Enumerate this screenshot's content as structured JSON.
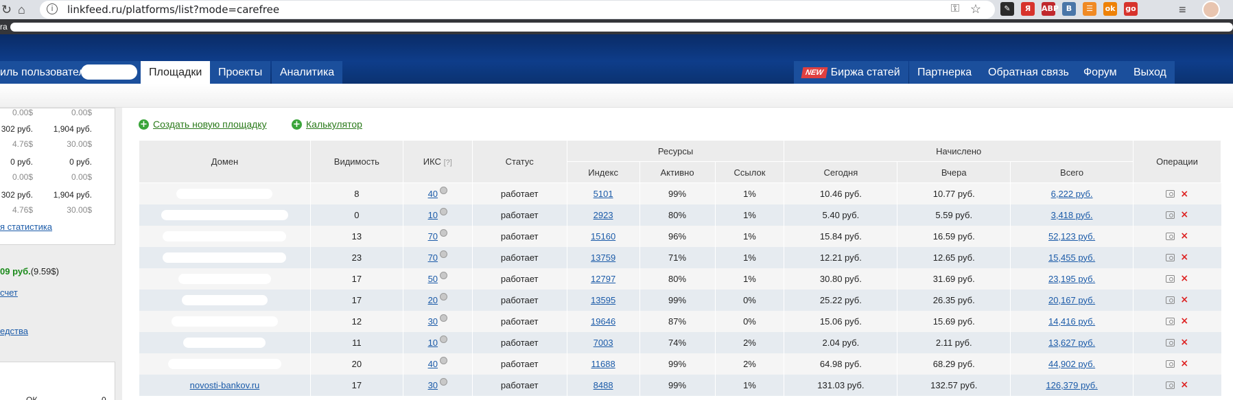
{
  "browser": {
    "url": "linkfeed.ru/platforms/list?mode=carefree",
    "bookmarks_label": "ra",
    "extensions": [
      {
        "name": "ext-bookmark-icon",
        "text": "✎",
        "color": "#2b2b2b"
      },
      {
        "name": "yandex-icon",
        "text": "Я",
        "color": "#d7332c"
      },
      {
        "name": "adblock-icon",
        "text": "ABP",
        "color": "#c0282d"
      },
      {
        "name": "vk-icon",
        "text": "B",
        "color": "#4a76a8"
      },
      {
        "name": "rss-icon",
        "text": "☰",
        "color": "#f08a24"
      },
      {
        "name": "odnoklassniki-icon",
        "text": "ok",
        "color": "#ee8208"
      },
      {
        "name": "go-icon",
        "text": "go",
        "color": "#d7332c"
      }
    ]
  },
  "nav": {
    "left_tabs": [
      "иль пользователя",
      "Площадки",
      "Проекты",
      "Аналитика"
    ],
    "new_badge": "NEW",
    "right_tabs": [
      "Биржа статей",
      "Партнерка",
      "Обратная связь",
      "Форум",
      "Выход"
    ]
  },
  "sidebar": {
    "rows": [
      {
        "a": "0.00$",
        "b": "0.00$",
        "grey": true
      },
      {
        "a": "302 руб.",
        "b": "1,904 руб.",
        "grey": false
      },
      {
        "a": "4.76$",
        "b": "30.00$",
        "grey": true
      },
      {
        "a": "0 руб.",
        "b": "0 руб.",
        "grey": false
      },
      {
        "a": "0.00$",
        "b": "0.00$",
        "grey": true
      },
      {
        "a": "302 руб.",
        "b": "1,904 руб.",
        "grey": false
      },
      {
        "a": "4.76$",
        "b": "30.00$",
        "grey": true
      }
    ],
    "stats_link": "я статистика",
    "balance_amount": "09 руб.",
    "balance_usd": "(9.59$)",
    "account_link": "счет",
    "funds_link": "едства",
    "bottom_text": "ОК",
    "bottom_value": "0"
  },
  "actions": {
    "create": "Создать новую площадку",
    "calculator": "Калькулятор"
  },
  "table": {
    "headers": {
      "domain": "Домен",
      "visibility": "Видимость",
      "iks": "ИКС",
      "iks_help": "[?]",
      "status": "Статус",
      "resources": "Ресурсы",
      "index": "Индекс",
      "active": "Активно",
      "links": "Ссылок",
      "accrued": "Начислено",
      "today": "Сегодня",
      "yesterday": "Вчера",
      "total": "Всего",
      "operations": "Операции"
    },
    "rows": [
      {
        "domain": "",
        "mask_width": 140,
        "visibility": "8",
        "iks": "40",
        "status": "работает",
        "index": "5101",
        "active": "99%",
        "links": "1%",
        "today": "10.46 руб.",
        "yesterday": "10.77 руб.",
        "total": "6,222 руб."
      },
      {
        "domain": "",
        "mask_width": 185,
        "visibility": "0",
        "iks": "10",
        "status": "работает",
        "index": "2923",
        "active": "80%",
        "links": "1%",
        "today": "5.40 руб.",
        "yesterday": "5.59 руб.",
        "total": "3,418 руб."
      },
      {
        "domain": "",
        "mask_width": 180,
        "visibility": "13",
        "iks": "70",
        "status": "работает",
        "index": "15160",
        "active": "96%",
        "links": "1%",
        "today": "15.84 руб.",
        "yesterday": "16.59 руб.",
        "total": "52,123 руб."
      },
      {
        "domain": "",
        "mask_width": 180,
        "visibility": "23",
        "iks": "70",
        "status": "работает",
        "index": "13759",
        "active": "71%",
        "links": "1%",
        "today": "12.21 руб.",
        "yesterday": "12.65 руб.",
        "total": "15,455 руб."
      },
      {
        "domain": "",
        "mask_width": 135,
        "visibility": "17",
        "iks": "50",
        "status": "работает",
        "index": "12797",
        "active": "80%",
        "links": "1%",
        "today": "30.80 руб.",
        "yesterday": "31.69 руб.",
        "total": "23,195 руб."
      },
      {
        "domain": "",
        "mask_width": 125,
        "visibility": "17",
        "iks": "20",
        "status": "работает",
        "index": "13595",
        "active": "99%",
        "links": "0%",
        "today": "25.22 руб.",
        "yesterday": "26.35 руб.",
        "total": "20,167 руб."
      },
      {
        "domain": "",
        "mask_width": 155,
        "visibility": "12",
        "iks": "30",
        "status": "работает",
        "index": "19646",
        "active": "87%",
        "links": "0%",
        "today": "15.06 руб.",
        "yesterday": "15.69 руб.",
        "total": "14,416 руб."
      },
      {
        "domain": "",
        "mask_width": 120,
        "visibility": "11",
        "iks": "10",
        "status": "работает",
        "index": "7003",
        "active": "74%",
        "links": "2%",
        "today": "2.04 руб.",
        "yesterday": "2.11 руб.",
        "total": "13,627 руб."
      },
      {
        "domain": "",
        "mask_width": 165,
        "visibility": "20",
        "iks": "40",
        "status": "работает",
        "index": "11688",
        "active": "99%",
        "links": "2%",
        "today": "64.98 руб.",
        "yesterday": "68.29 руб.",
        "total": "44,902 руб."
      },
      {
        "domain": "novosti-bankov.ru",
        "mask_width": 0,
        "visibility": "17",
        "iks": "30",
        "status": "работает",
        "index": "8488",
        "active": "99%",
        "links": "1%",
        "today": "131.03 руб.",
        "yesterday": "132.57 руб.",
        "total": "126,379 руб."
      }
    ]
  }
}
